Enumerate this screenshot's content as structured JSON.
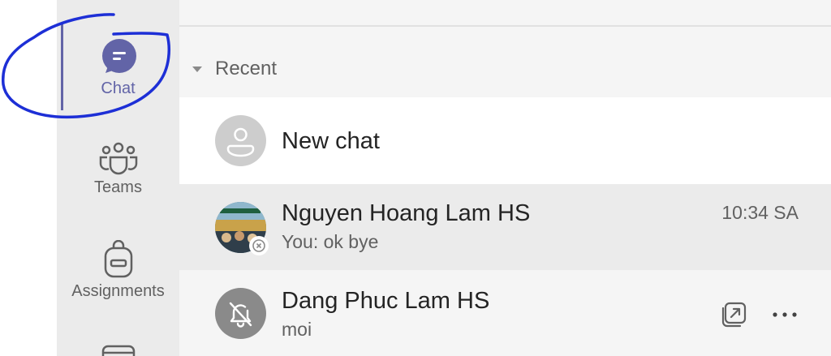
{
  "app_rail": {
    "items": [
      {
        "label": "Chat",
        "icon": "chat-icon",
        "active": true
      },
      {
        "label": "Teams",
        "icon": "teams-icon",
        "active": false
      },
      {
        "label": "Assignments",
        "icon": "assignments-icon",
        "active": false
      },
      {
        "label": "",
        "icon": "calendar-icon",
        "active": false
      }
    ],
    "accent_color": "#6264a7"
  },
  "chat_list": {
    "section_title": "Recent",
    "rows": [
      {
        "name": "New chat",
        "avatar": "person-icon"
      },
      {
        "name": "Nguyen Hoang Lam HS",
        "preview": "You: ok bye",
        "time": "10:34 SA",
        "avatar": "photo",
        "status": "offline-icon"
      },
      {
        "name": "Dang Phuc Lam HS",
        "preview": "moi",
        "avatar": "bell-off-icon",
        "actions": [
          "popout-icon",
          "more-options-icon"
        ]
      }
    ]
  },
  "annotation": {
    "color": "#1d2fd6",
    "shape": "hand-drawn circle around Chat"
  }
}
